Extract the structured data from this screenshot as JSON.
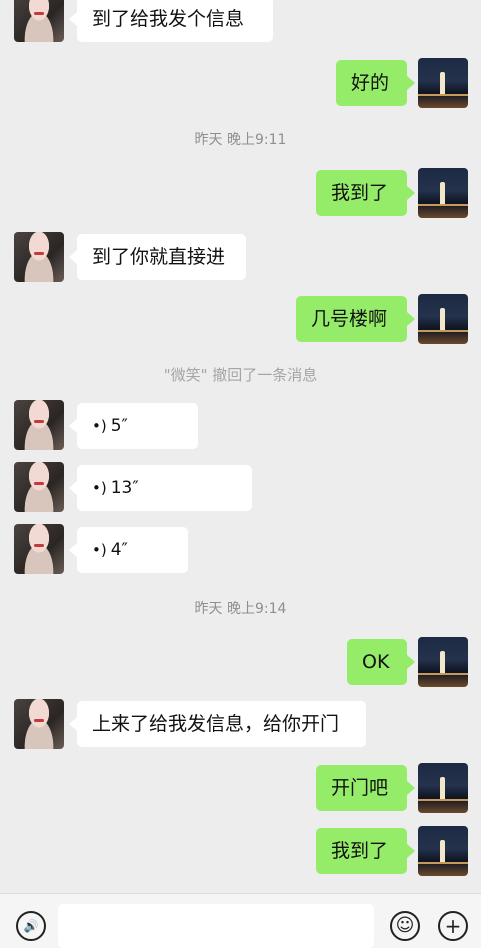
{
  "messages": [
    {
      "type": "text",
      "side": "left",
      "text": "到了给我发个信息"
    },
    {
      "type": "text",
      "side": "right",
      "text": "好的"
    },
    {
      "type": "time",
      "text": "昨天 晚上9:11"
    },
    {
      "type": "text",
      "side": "right",
      "text": "我到了"
    },
    {
      "type": "text",
      "side": "left",
      "text": "到了你就直接进"
    },
    {
      "type": "text",
      "side": "right",
      "text": "几号楼啊"
    },
    {
      "type": "system",
      "text": "\"微笑\" 撤回了一条消息"
    },
    {
      "type": "voice",
      "side": "left",
      "icon": "voice-wave-icon",
      "duration": "5″"
    },
    {
      "type": "voice",
      "side": "left",
      "icon": "voice-wave-icon",
      "duration": "13″"
    },
    {
      "type": "voice",
      "side": "left",
      "icon": "voice-wave-icon",
      "duration": "4″"
    },
    {
      "type": "time",
      "text": "昨天 晚上9:14"
    },
    {
      "type": "text",
      "side": "right",
      "text": "OK"
    },
    {
      "type": "text",
      "side": "left",
      "text": "上来了给我发信息，给你开门"
    },
    {
      "type": "text",
      "side": "right",
      "text": "开门吧"
    },
    {
      "type": "text",
      "side": "right",
      "text": "我到了"
    }
  ],
  "input_bar": {
    "voice_icon": "voice-input-icon",
    "emoji_icon": "emoji-icon",
    "plus_icon": "plus-icon",
    "voice_glyph": "🔊",
    "emoji_glyph": "☺",
    "plus_glyph": "+"
  },
  "colors": {
    "bubble_right": "#95ec69",
    "bubble_left": "#ffffff",
    "background": "#ededed"
  }
}
